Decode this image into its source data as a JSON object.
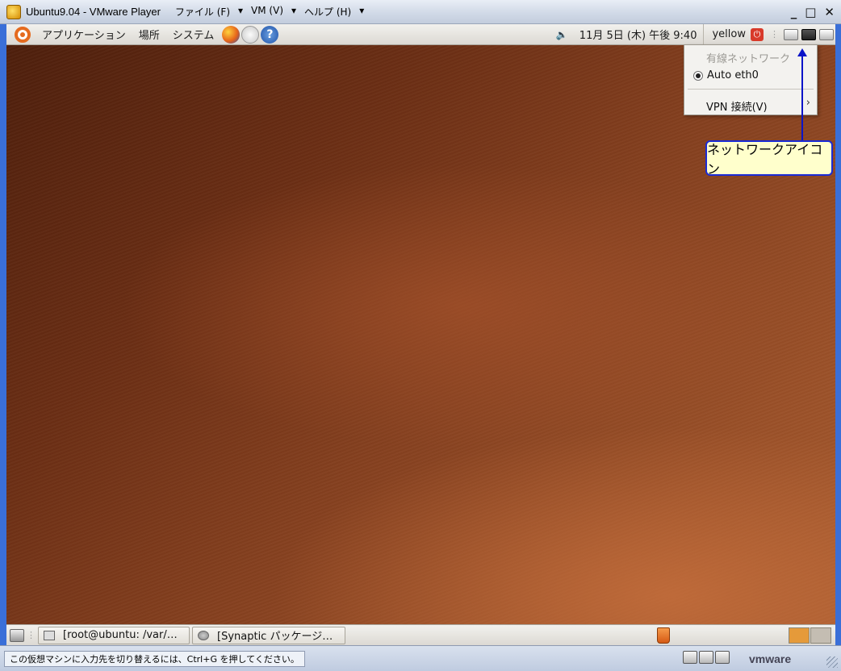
{
  "window": {
    "title": "Ubuntu9.04 - VMware Player",
    "menus": [
      "ファイル (F)",
      "VM (V)",
      "ヘルプ (H)"
    ],
    "controls": [
      "_",
      "□",
      "✕"
    ]
  },
  "top_panel": {
    "applications": "アプリケーション",
    "places": "場所",
    "system": "システム",
    "volume_icon": "speaker-icon",
    "clock": "11月 5日 (木) 午後 9:40",
    "user": "yellow"
  },
  "network_menu": {
    "header": "有線ネットワーク",
    "connection": "Auto eth0",
    "vpn": "VPN 接続(V)"
  },
  "callout": {
    "label": "ネットワークアイコン"
  },
  "bottom_panel": {
    "tasks": [
      {
        "label": "[root@ubuntu: /var/…"
      },
      {
        "label": "[Synaptic パッケージ…"
      }
    ]
  },
  "statusbar": {
    "hint": "この仮想マシンに入力先を切り替えるには、Ctrl+G を押してください。",
    "brand": "vmware"
  }
}
